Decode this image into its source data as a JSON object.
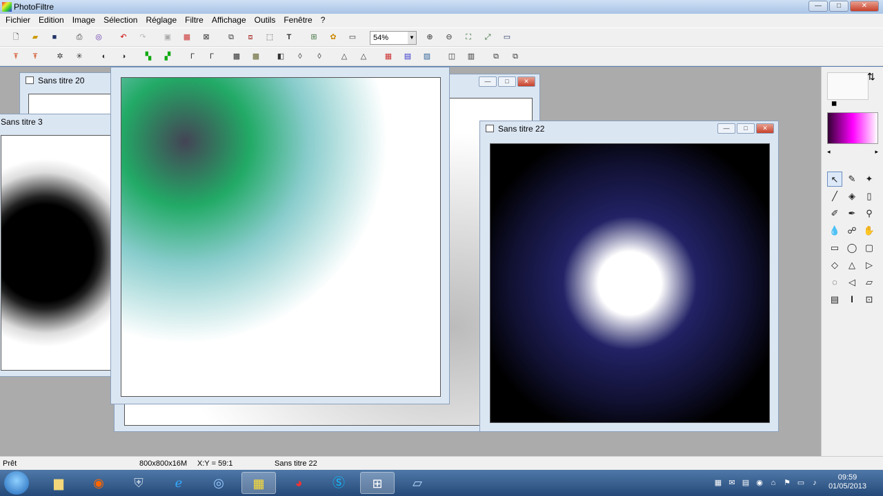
{
  "app": {
    "title": "PhotoFiltre"
  },
  "window_controls": {
    "min": "—",
    "max": "□",
    "close": "✕"
  },
  "menu": [
    "Fichier",
    "Edition",
    "Image",
    "Sélection",
    "Réglage",
    "Filtre",
    "Affichage",
    "Outils",
    "Fenêtre",
    "?"
  ],
  "toolbar": {
    "zoom": "54%"
  },
  "docs": {
    "doc20": {
      "title": "Sans titre 20"
    },
    "doc3": {
      "title": "Sans titre 3"
    },
    "doc22": {
      "title": "Sans titre 22"
    }
  },
  "status": {
    "ready": "Prêt",
    "size": "800x800x16M",
    "coords": "X:Y = 59:1",
    "doc": "Sans titre 22"
  },
  "clock": {
    "time": "09:59",
    "date": "01/05/2013"
  },
  "colors": {
    "accent": "#ff00ff",
    "workspace": "#ababab"
  }
}
